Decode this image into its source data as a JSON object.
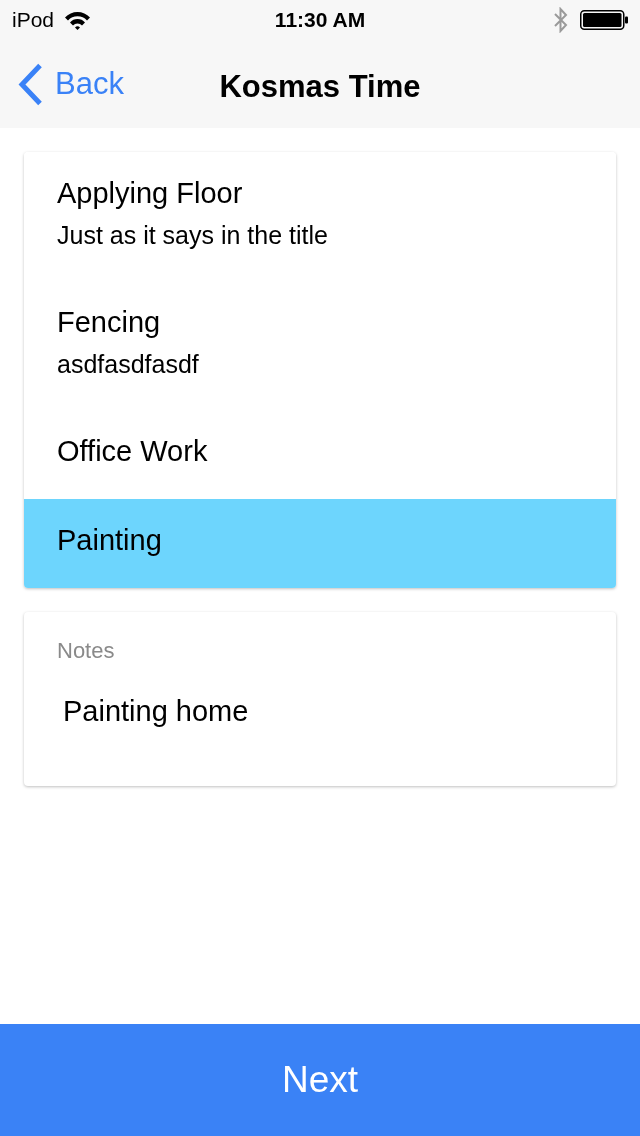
{
  "status_bar": {
    "carrier": "iPod",
    "time": "11:30 AM"
  },
  "nav_bar": {
    "back_label": "Back",
    "title": "Kosmas Time"
  },
  "task_list": [
    {
      "title": "Applying Floor",
      "subtitle": "Just as it says in the title",
      "selected": false
    },
    {
      "title": "Fencing",
      "subtitle": "asdfasdfasdf",
      "selected": false
    },
    {
      "title": "Office Work",
      "selected": false
    },
    {
      "title": "Painting",
      "selected": true
    }
  ],
  "notes": {
    "label": "Notes",
    "value": "Painting home"
  },
  "next_button": {
    "label": "Next"
  }
}
